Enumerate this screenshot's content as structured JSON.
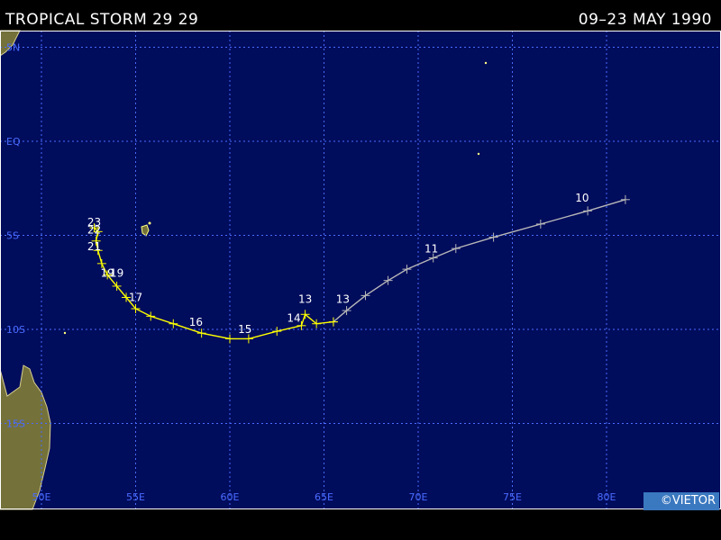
{
  "header": {
    "title": "TROPICAL STORM 29 29",
    "date_range": "09–23 MAY 1990"
  },
  "map": {
    "ocean_color": "#000c5c",
    "land_color": "#74713a",
    "grid_color": "#4a6cff",
    "lat_labels": [
      {
        "label": "5N",
        "lat": 5
      },
      {
        "label": "EQ",
        "lat": 0
      },
      {
        "label": "5S",
        "lat": -5
      },
      {
        "label": "10S",
        "lat": -10
      },
      {
        "label": "15S",
        "lat": -15
      }
    ],
    "lon_labels": [
      {
        "label": "50E",
        "lon": 50
      },
      {
        "label": "55E",
        "lon": 55
      },
      {
        "label": "60E",
        "lon": 60
      },
      {
        "label": "65E",
        "lon": 65
      },
      {
        "label": "70E",
        "lon": 70
      },
      {
        "label": "75E",
        "lon": 75
      },
      {
        "label": "80E",
        "lon": 80
      }
    ]
  },
  "track": {
    "early_color": "#b8b8b8",
    "late_color": "#ffff00",
    "early_points": [
      {
        "lon": 81.0,
        "lat": -3.1
      },
      {
        "lon": 79.0,
        "lat": -3.7
      },
      {
        "lon": 76.5,
        "lat": -4.4
      },
      {
        "lon": 74.0,
        "lat": -5.1
      },
      {
        "lon": 72.0,
        "lat": -5.7
      },
      {
        "lon": 70.8,
        "lat": -6.2
      },
      {
        "lon": 69.4,
        "lat": -6.8
      },
      {
        "lon": 68.4,
        "lat": -7.4
      },
      {
        "lon": 67.2,
        "lat": -8.2
      },
      {
        "lon": 66.2,
        "lat": -9.0
      },
      {
        "lon": 65.5,
        "lat": -9.6
      }
    ],
    "late_points": [
      {
        "lon": 65.5,
        "lat": -9.6
      },
      {
        "lon": 64.6,
        "lat": -9.7
      },
      {
        "lon": 64.0,
        "lat": -9.2
      },
      {
        "lon": 63.8,
        "lat": -9.8
      },
      {
        "lon": 62.5,
        "lat": -10.1
      },
      {
        "lon": 61.0,
        "lat": -10.5
      },
      {
        "lon": 60.0,
        "lat": -10.5
      },
      {
        "lon": 58.5,
        "lat": -10.2
      },
      {
        "lon": 57.0,
        "lat": -9.7
      },
      {
        "lon": 55.8,
        "lat": -9.3
      },
      {
        "lon": 55.0,
        "lat": -8.9
      },
      {
        "lon": 54.5,
        "lat": -8.3
      },
      {
        "lon": 54.0,
        "lat": -7.7
      },
      {
        "lon": 53.5,
        "lat": -7.1
      },
      {
        "lon": 53.2,
        "lat": -6.5
      },
      {
        "lon": 53.0,
        "lat": -5.8
      },
      {
        "lon": 52.9,
        "lat": -5.3
      },
      {
        "lon": 53.0,
        "lat": -4.8
      },
      {
        "lon": 52.8,
        "lat": -4.6
      }
    ],
    "day_labels": [
      {
        "text": "10",
        "lon": 78.7,
        "lat": -3.2,
        "color": "#ffffff"
      },
      {
        "text": "11",
        "lon": 70.7,
        "lat": -5.9,
        "color": "#ffffff"
      },
      {
        "text": "13",
        "lon": 66.0,
        "lat": -8.6,
        "color": "#ffffff"
      },
      {
        "text": "13",
        "lon": 64.0,
        "lat": -8.6,
        "color": "#ffffff"
      },
      {
        "text": "14",
        "lon": 63.4,
        "lat": -9.6,
        "color": "#ffffff"
      },
      {
        "text": "15",
        "lon": 60.8,
        "lat": -10.2,
        "color": "#ffffff"
      },
      {
        "text": "16",
        "lon": 58.2,
        "lat": -9.8,
        "color": "#ffffff"
      },
      {
        "text": "17",
        "lon": 55.0,
        "lat": -8.5,
        "color": "#ffffff"
      },
      {
        "text": "19",
        "lon": 53.5,
        "lat": -7.2,
        "color": "#ffffff"
      },
      {
        "text": "19",
        "lon": 54.0,
        "lat": -7.2,
        "color": "#ffffff"
      },
      {
        "text": "21",
        "lon": 52.8,
        "lat": -5.8,
        "color": "#ffffff"
      },
      {
        "text": "22",
        "lon": 52.8,
        "lat": -4.9,
        "color": "#ffffff"
      },
      {
        "text": "23",
        "lon": 52.8,
        "lat": -4.5,
        "color": "#ffffff"
      }
    ]
  },
  "copyright": "©VIETOR"
}
